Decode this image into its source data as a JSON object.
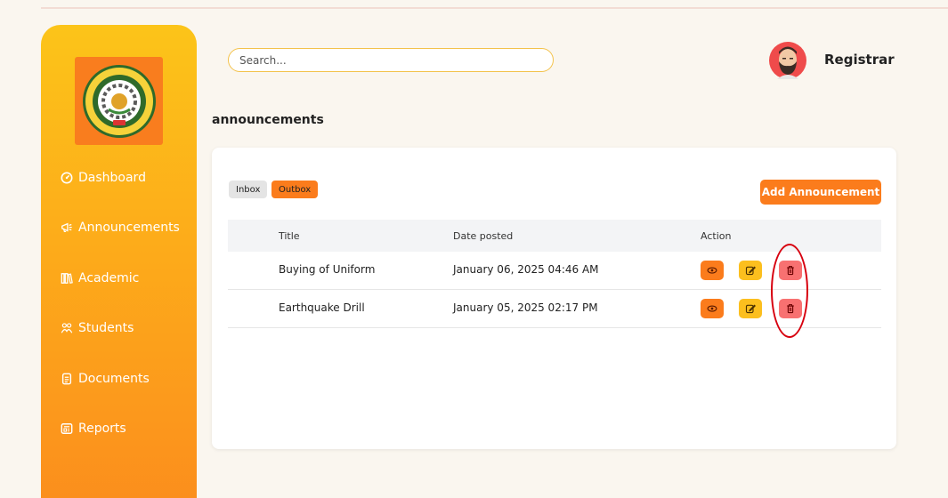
{
  "sidebar": {
    "items": [
      {
        "label": "Dashboard",
        "icon": "dashboard-icon"
      },
      {
        "label": "Announcements",
        "icon": "megaphone-icon"
      },
      {
        "label": "Academic",
        "icon": "books-icon"
      },
      {
        "label": "Students",
        "icon": "students-icon"
      },
      {
        "label": "Documents",
        "icon": "document-icon"
      },
      {
        "label": "Reports",
        "icon": "reports-icon"
      }
    ]
  },
  "header": {
    "search_placeholder": "Search...",
    "user_name": "Registrar"
  },
  "page": {
    "title": "announcements"
  },
  "tabs": {
    "inbox": "Inbox",
    "outbox": "Outbox"
  },
  "actions": {
    "add_label": "Add Announcement"
  },
  "table": {
    "columns": [
      "Title",
      "Date posted",
      "Action"
    ],
    "rows": [
      {
        "title": "Buying of Uniform",
        "date": "January 06, 2025 04:46 AM"
      },
      {
        "title": "Earthquake Drill",
        "date": "January 05, 2025 02:17 PM"
      }
    ]
  },
  "colors": {
    "accent_orange": "#fb7c1c",
    "accent_yellow": "#fcbf1e",
    "danger": "#f87171",
    "annotation": "#d7000f"
  }
}
